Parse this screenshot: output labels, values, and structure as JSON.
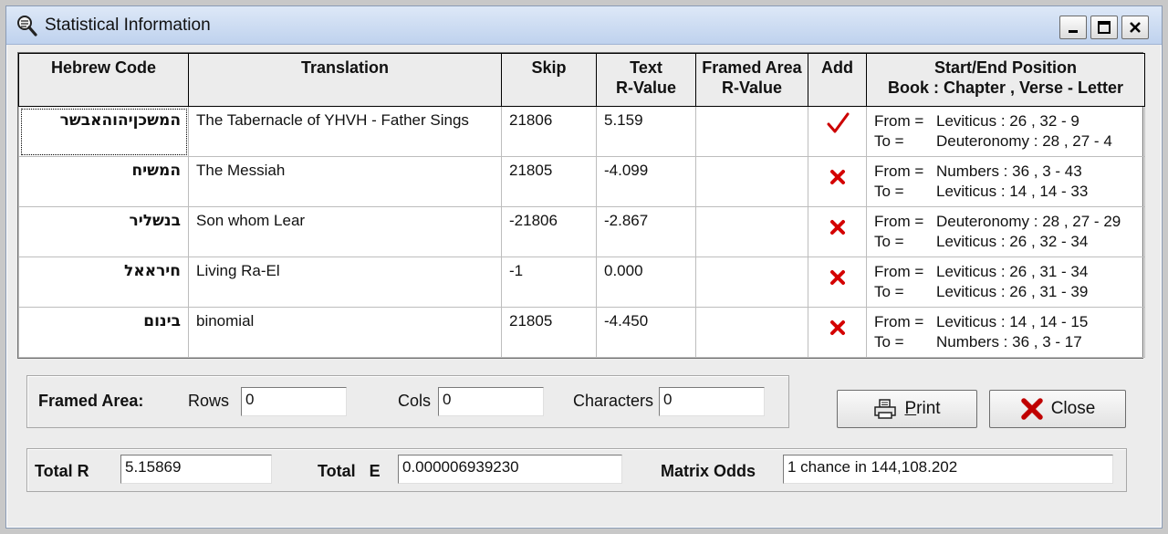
{
  "window": {
    "title": "Statistical Information"
  },
  "table": {
    "headers": {
      "code": "Hebrew Code",
      "translation": "Translation",
      "skip": "Skip",
      "text_r_1": "Text",
      "text_r_2": "R-Value",
      "framed_1": "Framed Area",
      "framed_2": "R-Value",
      "add": "Add",
      "pos_1": "Start/End Position",
      "pos_2": "Book : Chapter , Verse - Letter"
    },
    "from_label": "From =",
    "to_label": "To =",
    "rows": [
      {
        "code": "המשכןיהוהאבשר",
        "translation": "The Tabernacle of YHVH - Father Sings",
        "skip": "21806",
        "text_r": "5.159",
        "framed_r": "",
        "add": "check-icon",
        "from": "Leviticus : 26 , 32 - 9",
        "to": "Deuteronomy : 28 , 27 - 4"
      },
      {
        "code": "המשיח",
        "translation": "The Messiah",
        "skip": "21805",
        "text_r": "-4.099",
        "framed_r": "",
        "add": "x-icon",
        "from": "Numbers : 36 , 3 - 43",
        "to": "Leviticus : 14 , 14 - 33"
      },
      {
        "code": "בנשליר",
        "translation": "Son whom Lear",
        "skip": "-21806",
        "text_r": "-2.867",
        "framed_r": "",
        "add": "x-icon",
        "from": "Deuteronomy : 28 , 27 - 29",
        "to": "Leviticus : 26 , 32 - 34"
      },
      {
        "code": "חיראאל",
        "translation": "Living Ra-El",
        "skip": "-1",
        "text_r": "0.000",
        "framed_r": "",
        "add": "x-icon",
        "from": "Leviticus : 26 , 31 - 34",
        "to": "Leviticus : 26 , 31 - 39"
      },
      {
        "code": "בינום",
        "translation": "binomial",
        "skip": "21805",
        "text_r": "-4.450",
        "framed_r": "",
        "add": "x-icon",
        "from": "Leviticus : 14 , 14 - 15",
        "to": "Numbers : 36 , 3 - 17"
      }
    ]
  },
  "framed": {
    "label": "Framed Area:",
    "rows_label": "Rows",
    "rows_value": "0",
    "cols_label": "Cols",
    "cols_value": "0",
    "chars_label": "Characters",
    "chars_value": "0"
  },
  "totals": {
    "total_r_label": "Total R",
    "total_r_value": "5.15869",
    "total_e_label": "Total   E",
    "total_e_value": "0.000006939230",
    "odds_label": "Matrix Odds",
    "odds_value": "1 chance in 144,108.202"
  },
  "buttons": {
    "print_hotkey": "P",
    "print_rest": "rint",
    "close": "Close"
  },
  "colors": {
    "check": "#cc0000",
    "x": "#d40000",
    "titlebar": "#c8d9f1"
  }
}
